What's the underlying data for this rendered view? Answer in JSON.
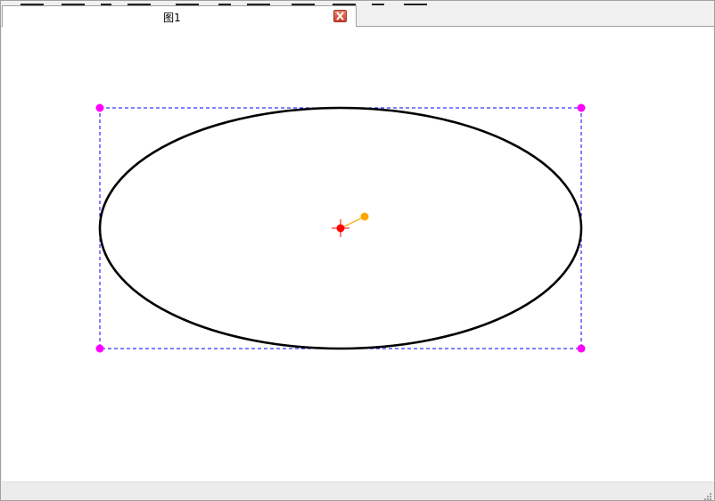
{
  "tab": {
    "title": "图1",
    "close_icon": "close-icon"
  },
  "colors": {
    "ellipse_stroke": "#000000",
    "bounding_box": "#0000ff",
    "corner_handle": "#ff00ff",
    "center_point": "#ff0000",
    "rotation_handle": "#ffa500",
    "tab_close": "#d9573d"
  },
  "icons": {
    "center": "crosshair-icon",
    "rotation": "rotation-handle-icon",
    "status_grip": "resize-grip-icon"
  }
}
